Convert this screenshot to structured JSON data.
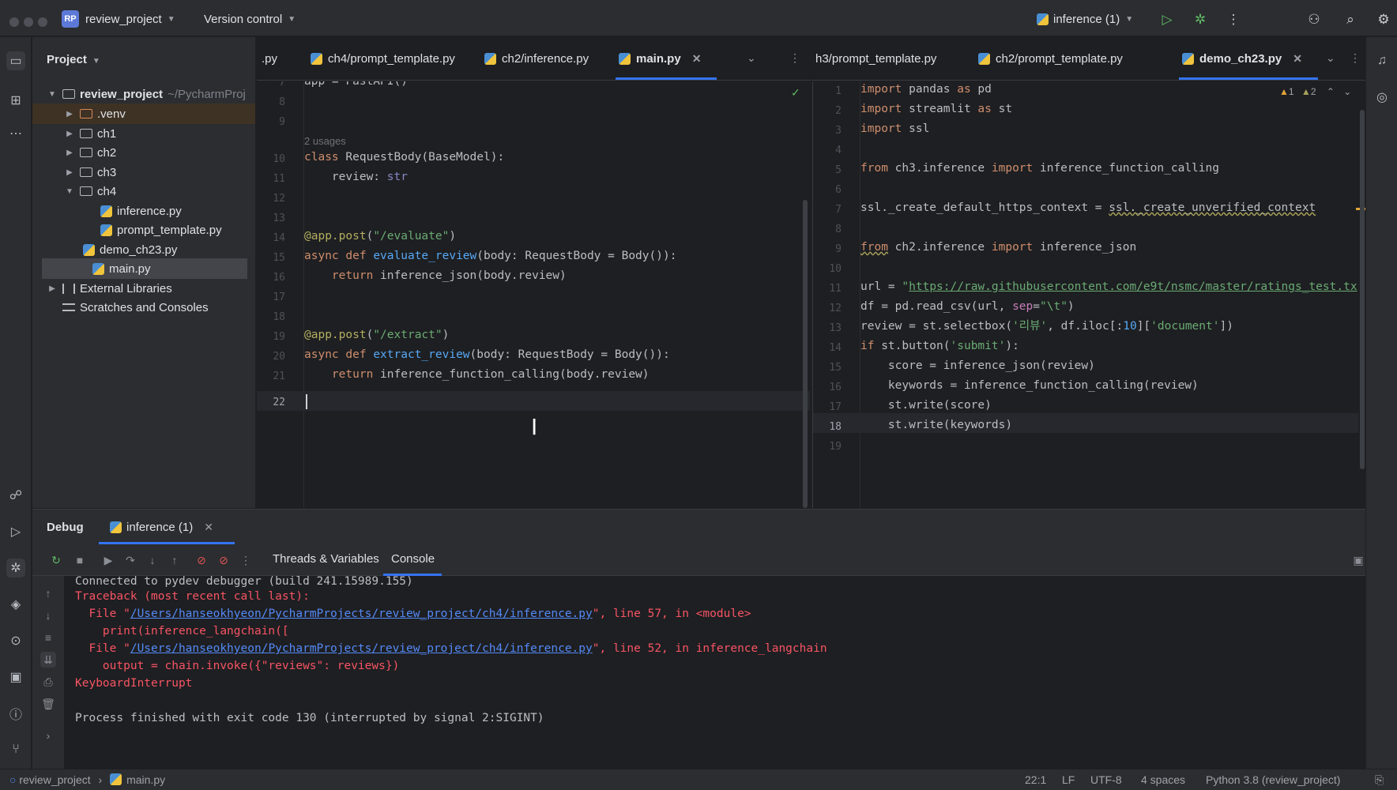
{
  "titlebar": {
    "project_badge": "RP",
    "project_name": "review_project",
    "vcs": "Version control",
    "run_config": "inference (1)"
  },
  "project_panel": {
    "title": "Project",
    "root": "review_project",
    "root_path": "~/PycharmProj",
    "items": [
      {
        "label": ".venv"
      },
      {
        "label": "ch1"
      },
      {
        "label": "ch2"
      },
      {
        "label": "ch3"
      },
      {
        "label": "ch4"
      },
      {
        "label": "inference.py"
      },
      {
        "label": "prompt_template.py"
      },
      {
        "label": "demo_ch23.py"
      },
      {
        "label": "main.py"
      },
      {
        "label": "External Libraries"
      },
      {
        "label": "Scratches and Consoles"
      }
    ]
  },
  "editor_left": {
    "tabs": [
      {
        "label": ".py"
      },
      {
        "label": "ch4/prompt_template.py"
      },
      {
        "label": "ch2/inference.py"
      },
      {
        "label": "main.py"
      }
    ],
    "usages": "2 usages",
    "lines": [
      {
        "n": "7",
        "text": "app = FastAPI()"
      },
      {
        "n": "8",
        "text": ""
      },
      {
        "n": "9",
        "text": ""
      },
      {
        "n": "10",
        "text": "class RequestBody(BaseModel):"
      },
      {
        "n": "11",
        "text": "    review: str"
      },
      {
        "n": "12",
        "text": ""
      },
      {
        "n": "13",
        "text": ""
      },
      {
        "n": "14",
        "text": "@app.post(\"/evaluate\")"
      },
      {
        "n": "15",
        "text": "async def evaluate_review(body: RequestBody = Body()):"
      },
      {
        "n": "16",
        "text": "    return inference_json(body.review)"
      },
      {
        "n": "17",
        "text": ""
      },
      {
        "n": "18",
        "text": ""
      },
      {
        "n": "19",
        "text": "@app.post(\"/extract\")"
      },
      {
        "n": "20",
        "text": "async def extract_review(body: RequestBody = Body()):"
      },
      {
        "n": "21",
        "text": "    return inference_function_calling(body.review)"
      },
      {
        "n": "22",
        "text": ""
      }
    ]
  },
  "editor_right": {
    "tabs": [
      {
        "label": "h3/prompt_template.py"
      },
      {
        "label": "ch2/prompt_template.py"
      },
      {
        "label": "demo_ch23.py"
      }
    ],
    "warnings": "1",
    "weak_warnings": "2",
    "lines": [
      {
        "n": "1",
        "text": "import pandas as pd"
      },
      {
        "n": "2",
        "text": "import streamlit as st"
      },
      {
        "n": "3",
        "text": "import ssl"
      },
      {
        "n": "4",
        "text": ""
      },
      {
        "n": "5",
        "text": "from ch3.inference import inference_function_calling"
      },
      {
        "n": "6",
        "text": ""
      },
      {
        "n": "7",
        "text": "ssl._create_default_https_context = ssl._create_unverified_context"
      },
      {
        "n": "8",
        "text": ""
      },
      {
        "n": "9",
        "text": "from ch2.inference import inference_json"
      },
      {
        "n": "10",
        "text": ""
      },
      {
        "n": "11",
        "text": "url = \"https://raw.githubusercontent.com/e9t/nsmc/master/ratings_test.tx"
      },
      {
        "n": "12",
        "text": "df = pd.read_csv(url, sep=\"\\t\")"
      },
      {
        "n": "13",
        "text": "review = st.selectbox('리뷰', df.iloc[:10]['document'])"
      },
      {
        "n": "14",
        "text": "if st.button('submit'):"
      },
      {
        "n": "15",
        "text": "    score = inference_json(review)"
      },
      {
        "n": "16",
        "text": "    keywords = inference_function_calling(review)"
      },
      {
        "n": "17",
        "text": "    st.write(score)"
      },
      {
        "n": "18",
        "text": "    st.write(keywords)"
      },
      {
        "n": "19",
        "text": ""
      }
    ]
  },
  "debug": {
    "title": "Debug",
    "session_tab": "inference (1)",
    "subtabs": [
      "Threads & Variables",
      "Console"
    ],
    "console": [
      "Connected to pydev debugger (build 241.15989.155)",
      "Traceback (most recent call last):",
      "  File \"",
      "/Users/hanseokhyeon/PycharmProjects/review_project/ch4/inference.py",
      "\", line 57, in <module>",
      "    print(inference_langchain([",
      "  File \"",
      "/Users/hanseokhyeon/PycharmProjects/review_project/ch4/inference.py",
      "\", line 52, in inference_langchain",
      "    output = chain.invoke({\"reviews\": reviews})",
      "KeyboardInterrupt",
      "",
      "Process finished with exit code 130 (interrupted by signal 2:SIGINT)"
    ]
  },
  "statusbar": {
    "project": "review_project",
    "file": "main.py",
    "position": "22:1",
    "line_sep": "LF",
    "encoding": "UTF-8",
    "indent": "4 spaces",
    "interpreter": "Python 3.8 (review_project)"
  },
  "colors": {
    "accent": "#3574f0",
    "error": "#f75464",
    "link": "#548af7",
    "keyword": "#cf8e6d",
    "function": "#56a8f5",
    "string": "#6aab73"
  }
}
